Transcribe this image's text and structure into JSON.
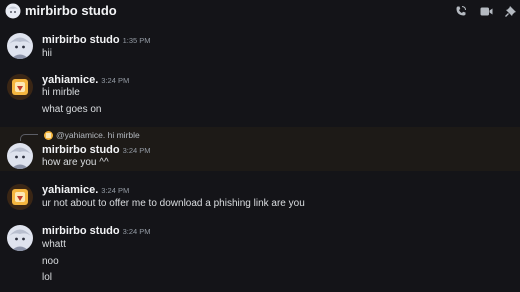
{
  "header": {
    "channel_name": "mirbirbo studo",
    "icons": [
      "at-icon",
      "phone-icon",
      "video-icon",
      "pin-icon"
    ]
  },
  "messages": [
    {
      "author": "mirbirbo studo",
      "time": "1:35 PM",
      "lines": [
        "hii"
      ]
    },
    {
      "author": "yahiamice.",
      "time": "3:24 PM",
      "lines": [
        "hi mirble",
        "what goes on"
      ]
    },
    {
      "reply_to": "@yahiamice. hi mirble",
      "author": "mirbirbo studo",
      "time": "3:24 PM",
      "lines": [
        "how are you ^^"
      ]
    },
    {
      "author": "yahiamice.",
      "time": "3:24 PM",
      "lines": [
        "ur not about to offer me to download a phishing link are you"
      ]
    },
    {
      "author": "mirbirbo studo",
      "time": "3:24 PM",
      "lines": [
        "whatt",
        "noo",
        "lol"
      ]
    }
  ],
  "colors": {
    "background": "#141418",
    "highlight_row": "#1d1a17",
    "username": "#f2f3f5",
    "timestamp": "#949ba4",
    "text": "#dbdee1"
  }
}
